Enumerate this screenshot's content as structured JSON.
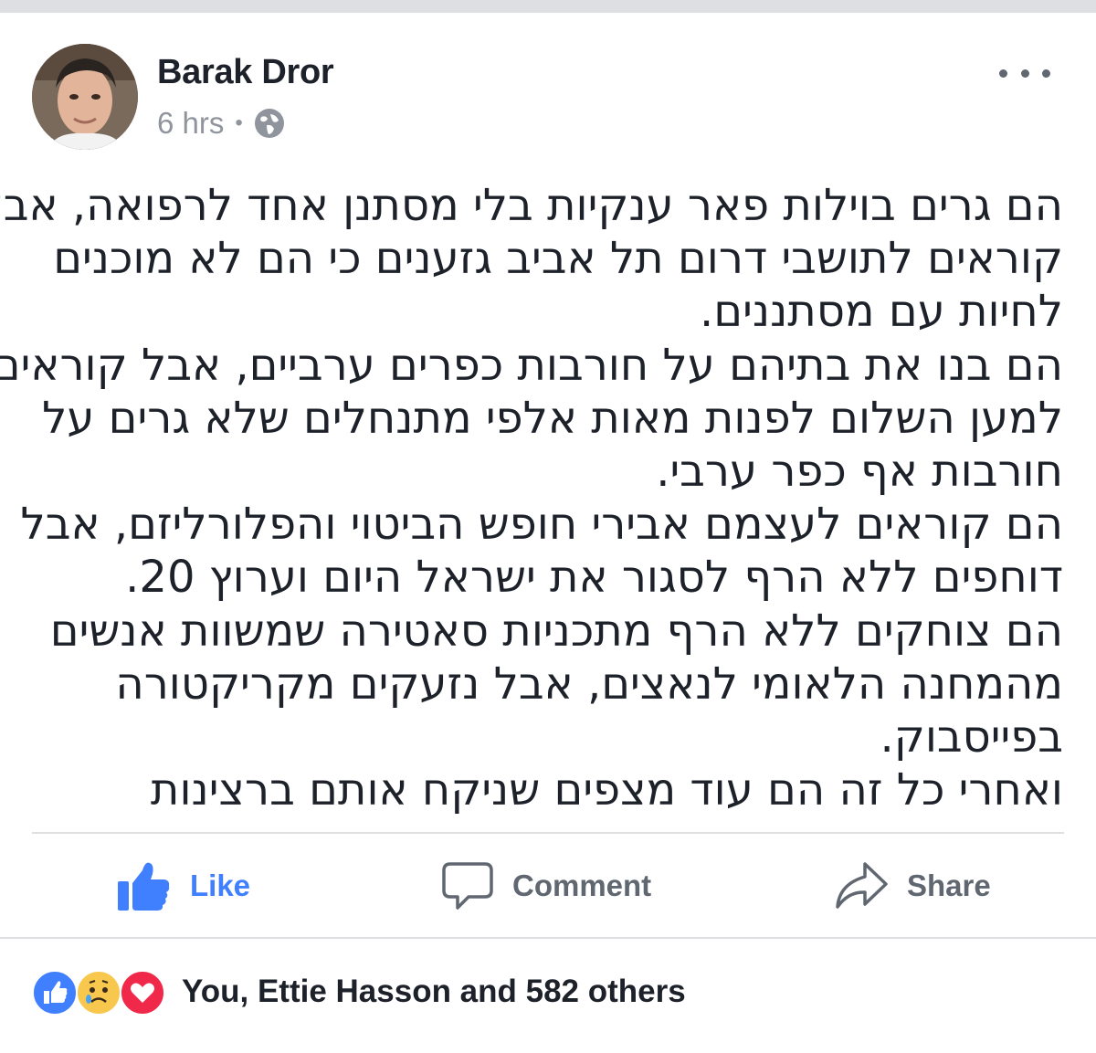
{
  "post": {
    "author": "Barak Dror",
    "time": "6 hrs",
    "separator": "•",
    "lines": [
      "הם גרים בוילות פאר ענקיות בלי מסתנן אחד לרפואה, אבל",
      "קוראים לתושבי דרום תל אביב גזענים כי הם לא מוכנים",
      "לחיות עם מסתננים.",
      "הם בנו את בתיהם על חורבות כפרים ערביים, אבל קוראים",
      "למען השלום לפנות מאות אלפי מתנחלים שלא גרים על",
      "חורבות אף כפר ערבי.",
      "הם קוראים לעצמם אבירי חופש הביטוי והפלורליזם, אבל",
      "דוחפים ללא הרף לסגור את ישראל היום וערוץ 20.",
      "הם צוחקים ללא הרף מתכניות סאטירה שמשוות אנשים",
      "מהמחנה הלאומי לנאצים, אבל נזעקים מקריקטורה",
      "בפייסבוק.",
      "ואחרי כל זה הם עוד מצפים שניקח אותם ברצינות"
    ]
  },
  "actions": {
    "like": "Like",
    "comment": "Comment",
    "share": "Share"
  },
  "reactions": {
    "summary": "You, Ettie Hasson and 582 others",
    "icons": [
      "like-reaction-icon",
      "sad-reaction-icon",
      "love-reaction-icon"
    ]
  },
  "colors": {
    "accent": "#4080ff",
    "love": "#f0284a",
    "sad": "#f7c84d",
    "muted": "#90949c",
    "divider": "#dddfe2"
  }
}
